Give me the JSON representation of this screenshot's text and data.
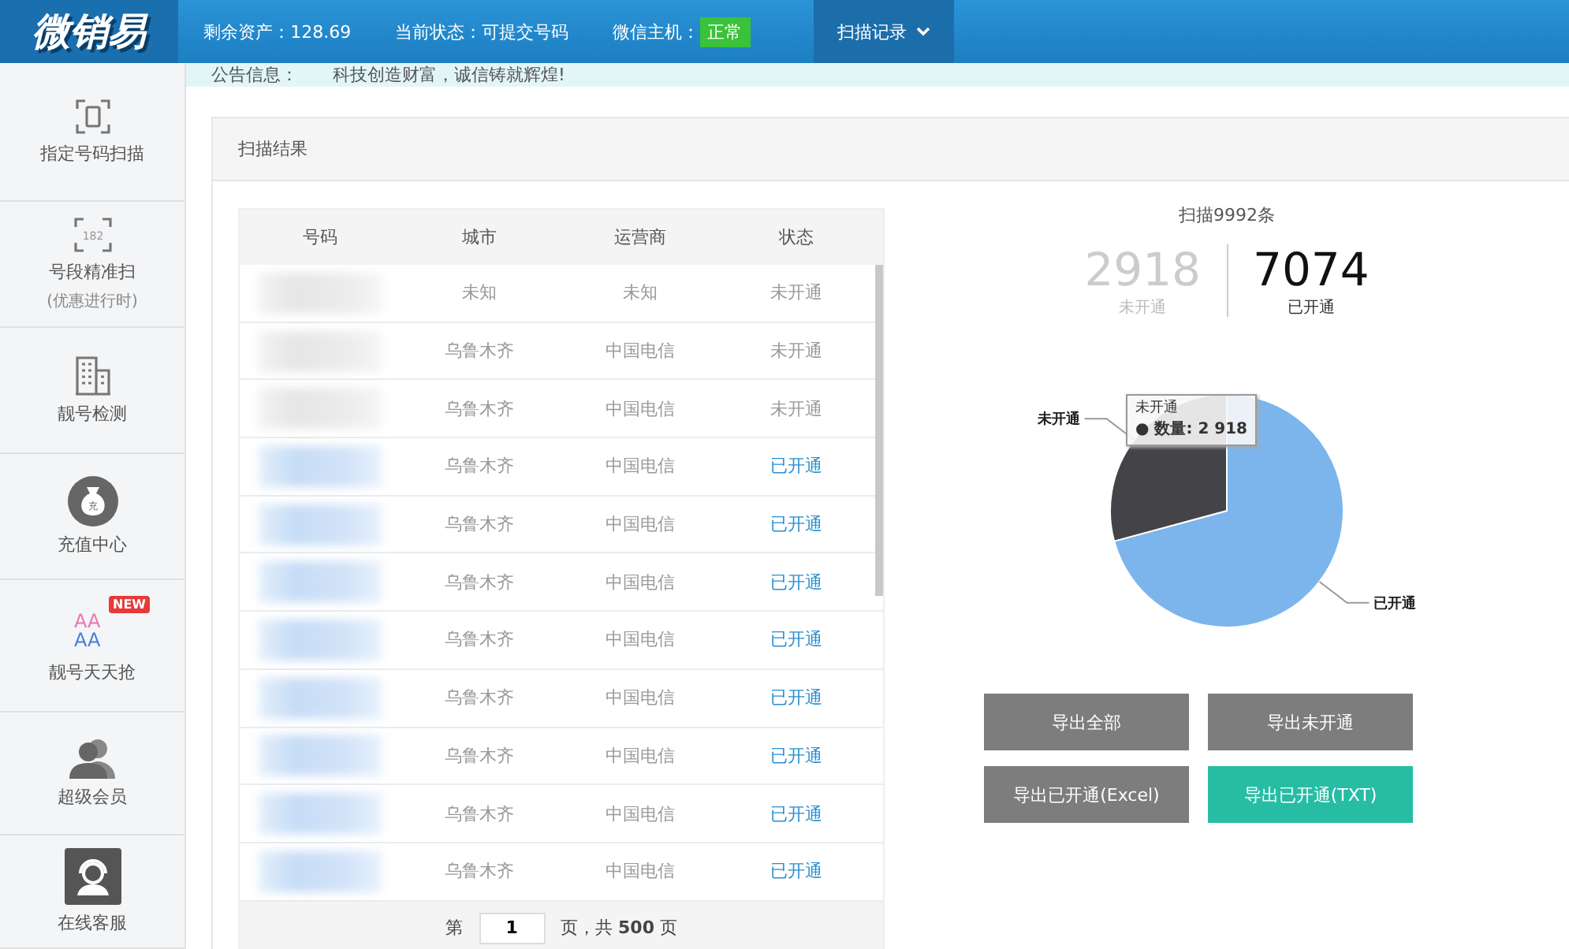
{
  "logo": "微销易",
  "topbar": {
    "balance": "剩余资产：128.69",
    "status": "当前状态：可提交号码",
    "host_label": "微信主机：",
    "host_badge": "正常",
    "host_ok": true,
    "menu": "扫描记录"
  },
  "notice": {
    "label": "公告信息：",
    "text": "科技创造财富，诚信铸就辉煌!"
  },
  "sidebar": {
    "items": [
      {
        "kind": "scan",
        "label": "指定号码扫描"
      },
      {
        "kind": "segment",
        "label": "号段精准扫",
        "sub": "(优惠进行时)",
        "icon_text": "182"
      },
      {
        "kind": "building",
        "label": "靓号检测"
      },
      {
        "kind": "bag",
        "label": "充值中心",
        "icon_text": "充"
      },
      {
        "kind": "letters",
        "label": "靓号天天抢",
        "badge": "NEW",
        "icon_lines": [
          "AA",
          "AA"
        ]
      },
      {
        "kind": "users",
        "label": "超级会员"
      },
      {
        "kind": "support",
        "label": "在线客服"
      }
    ]
  },
  "panel": {
    "title": "扫描结果"
  },
  "table": {
    "columns": [
      "号码",
      "城市",
      "运营商",
      "状态"
    ],
    "rows": [
      {
        "city": "未知",
        "carrier": "未知",
        "status": "未开通",
        "open": false
      },
      {
        "city": "乌鲁木齐",
        "carrier": "中国电信",
        "status": "未开通",
        "open": false
      },
      {
        "city": "乌鲁木齐",
        "carrier": "中国电信",
        "status": "未开通",
        "open": false
      },
      {
        "city": "乌鲁木齐",
        "carrier": "中国电信",
        "status": "已开通",
        "open": true
      },
      {
        "city": "乌鲁木齐",
        "carrier": "中国电信",
        "status": "已开通",
        "open": true
      },
      {
        "city": "乌鲁木齐",
        "carrier": "中国电信",
        "status": "已开通",
        "open": true
      },
      {
        "city": "乌鲁木齐",
        "carrier": "中国电信",
        "status": "已开通",
        "open": true
      },
      {
        "city": "乌鲁木齐",
        "carrier": "中国电信",
        "status": "已开通",
        "open": true
      },
      {
        "city": "乌鲁木齐",
        "carrier": "中国电信",
        "status": "已开通",
        "open": true
      },
      {
        "city": "乌鲁木齐",
        "carrier": "中国电信",
        "status": "已开通",
        "open": true
      },
      {
        "city": "乌鲁木齐",
        "carrier": "中国电信",
        "status": "已开通",
        "open": true
      }
    ],
    "pager": {
      "prefix": "第",
      "page": "1",
      "suffix": "页，共 **500** 页"
    }
  },
  "summary": {
    "title": "扫描9992条",
    "stats": [
      {
        "value": "2918",
        "label": "未开通",
        "selected": false
      },
      {
        "value": "7074",
        "label": "已开通",
        "selected": true
      }
    ]
  },
  "chart_data": {
    "type": "pie",
    "categories": [
      "已开通",
      "未开通"
    ],
    "series": [
      {
        "values": [
          70.8,
          29.2
        ],
        "colors": [
          "#7cb5ec",
          "#434348"
        ]
      }
    ]
  },
  "tooltip": {
    "title": "未开通",
    "text": "● 数量: 2 918"
  },
  "buttons": [
    {
      "label": "导出全部",
      "kind": "plain"
    },
    {
      "label": "导出未开通",
      "kind": "plain"
    },
    {
      "label": "导出已开通(Excel)",
      "kind": "plain"
    },
    {
      "label": "导出已开通(TXT)",
      "kind": "primary"
    }
  ]
}
